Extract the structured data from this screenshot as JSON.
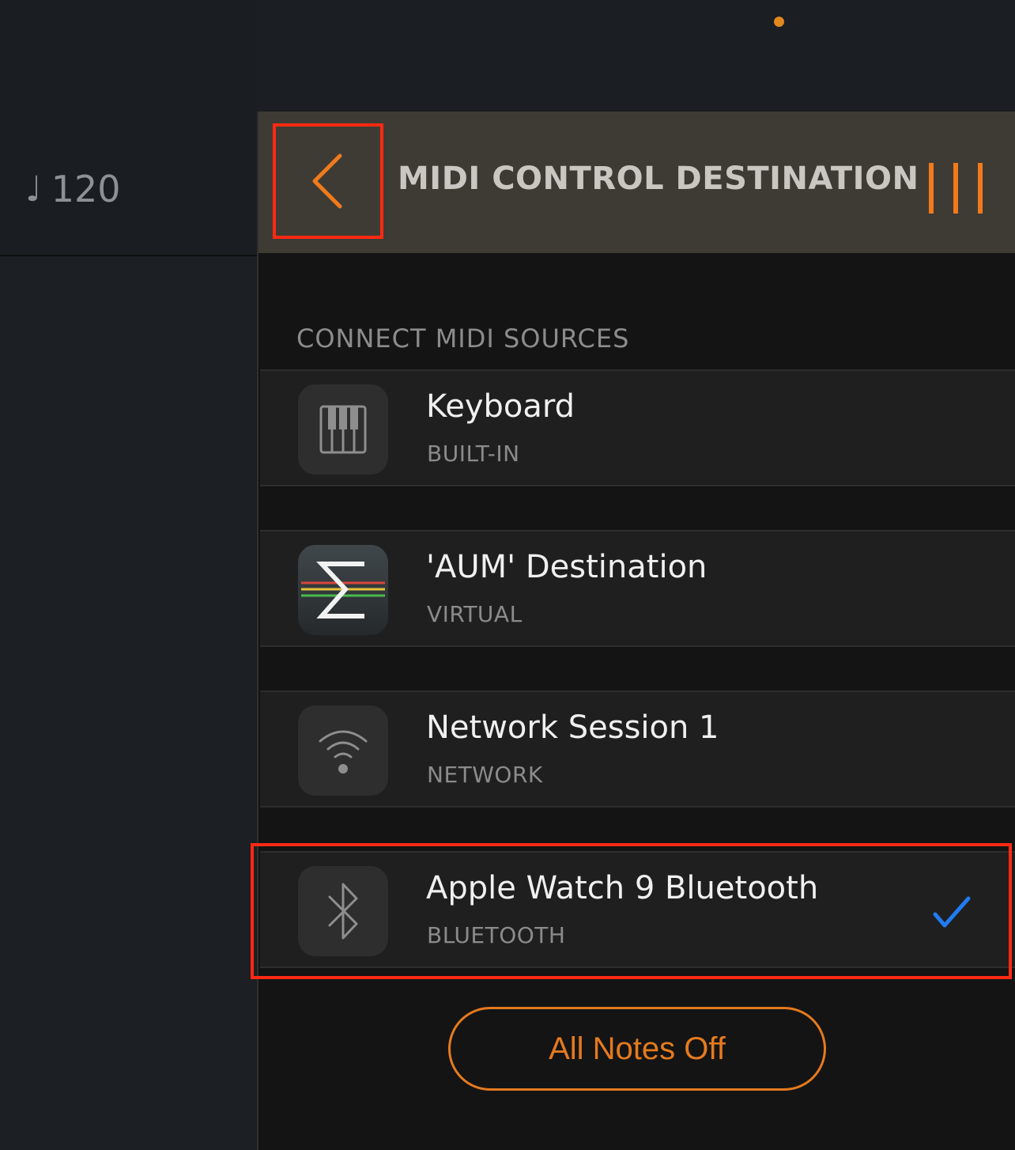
{
  "status_bar": {
    "indicator_color": "#e0881e"
  },
  "transport": {
    "tempo_icon": "quarter-note-icon",
    "tempo_glyph": "♩",
    "tempo_value": "120"
  },
  "header": {
    "back_icon": "chevron-left-icon",
    "title": "MIDI CONTROL DESTINATION",
    "meter_icon": "level-meter-icon",
    "accent_color": "#f07a1c"
  },
  "section": {
    "label": "CONNECT MIDI SOURCES"
  },
  "sources": [
    {
      "name": "Keyboard",
      "type": "BUILT-IN",
      "icon": "piano-keys-icon",
      "selected": false
    },
    {
      "name": "'AUM' Destination",
      "type": "VIRTUAL",
      "icon": "aum-sigma-icon",
      "selected": false
    },
    {
      "name": "Network Session 1",
      "type": "NETWORK",
      "icon": "wifi-icon",
      "selected": false
    },
    {
      "name": "Apple Watch 9 Bluetooth",
      "type": "BLUETOOTH",
      "icon": "bluetooth-icon",
      "selected": true
    }
  ],
  "selected_check_color": "#1f7cf2",
  "footer": {
    "all_notes_off_label": "All Notes Off"
  }
}
